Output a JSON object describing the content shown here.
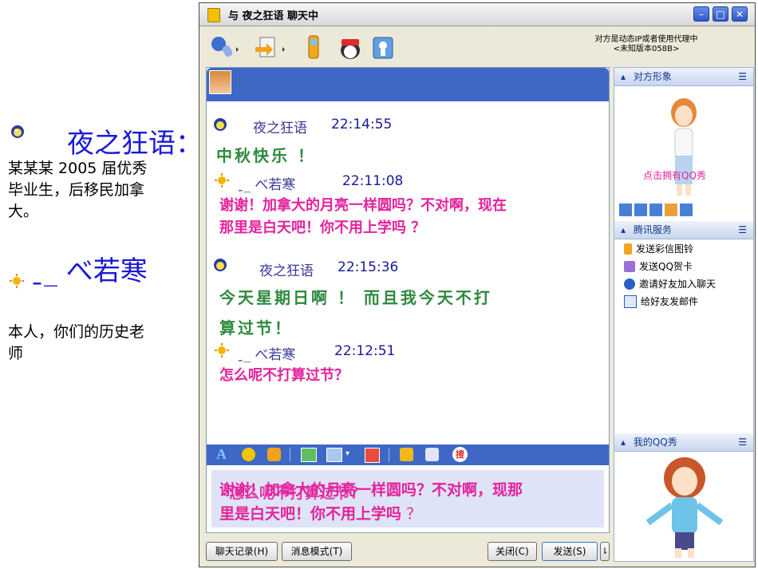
{
  "slide": {
    "person1_name": "夜之狂语：",
    "person1_desc_line1": "某某某 2005 届优秀",
    "person1_desc_line2": "毕业生，后移民加拿",
    "person1_desc_line3": "大。",
    "person2_name": "ˍ_ べ若寒",
    "person2_desc_line1": "本人，你们的历史老",
    "person2_desc_line2": "师"
  },
  "window": {
    "title": "与 夜之狂语 聊天中",
    "minimize": "–",
    "maximize": "□",
    "close": "✕",
    "note_line1": "对方是动态IP或者使用代理中",
    "note_line2": "<未知版本058B>"
  },
  "messages": [
    {
      "name": "夜之狂语",
      "time": "22:14:55",
      "text": "中秋快乐 ！"
    },
    {
      "name": "ˍ_ べ若寒",
      "time": "22:11:08",
      "text_line1": "谢谢！加拿大的月亮一样圆吗？不对啊，现在",
      "text_line2": "那里是白天吧！你不用上学吗 ？"
    },
    {
      "name": "夜之狂语",
      "time": "22:15:36",
      "text_line1": "今天星期日啊 ！ 而且我今天不打",
      "text_line2": "算过节！"
    },
    {
      "name": "ˍ_ べ若寒",
      "time": "22:12:51",
      "text": "怎么呢不打算过节？"
    }
  ],
  "input": {
    "line1": "谢谢！加拿大的月亮一样圆吗？不对啊，现那",
    "line2_a": "里是白天吧！",
    "line2_b": "你不用上学吗",
    "line2_c": " ？",
    "overlay": "怎么呢不打算过节？"
  },
  "buttons": {
    "history": "聊天记录(H)",
    "mode": "消息模式(T)",
    "close": "关闭(C)",
    "send": "发送(S)",
    "send_arrow": "⇂"
  },
  "sidebar": {
    "head1": "对方形象",
    "show_link": "点击拥有QQ秀",
    "head2": "腾讯服务",
    "services": [
      "发送彩信图铃",
      "发送QQ贺卡",
      "邀请好友加入聊天",
      "给好友发邮件"
    ],
    "head3": "我的QQ秀"
  },
  "colors": {
    "accent_blue": "#3f67c6",
    "pink_text": "#e4229b",
    "green_text": "#2d8a3e",
    "name_blue": "#1a1ad8"
  }
}
